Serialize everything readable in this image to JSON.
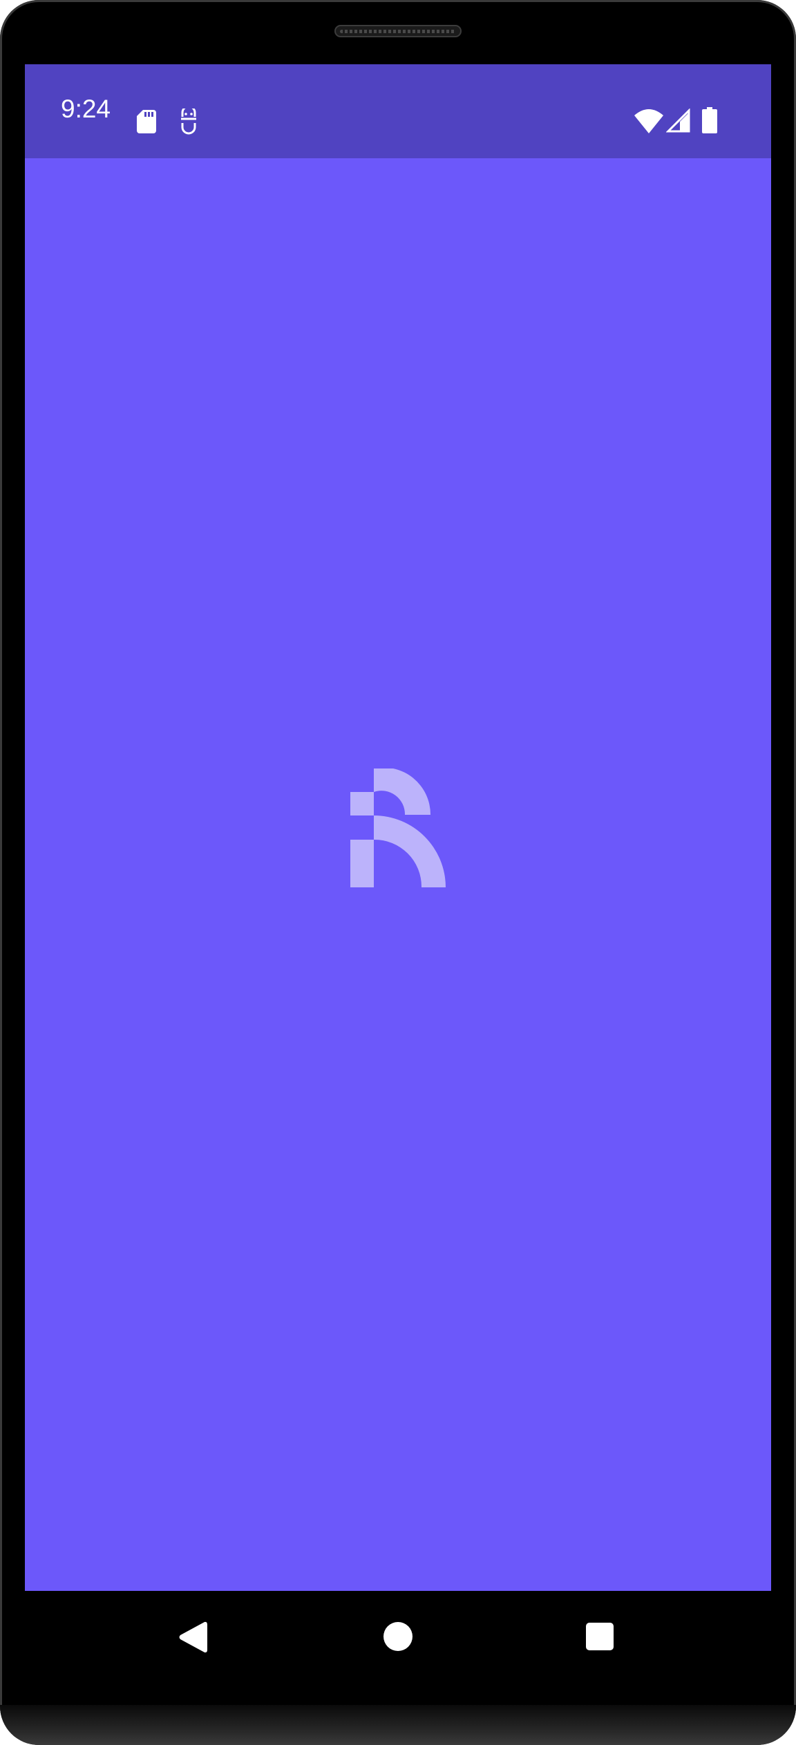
{
  "status_bar": {
    "time": "9:24",
    "left_icons": [
      "sd-card-icon",
      "debug-icon"
    ],
    "right_icons": [
      "wifi-icon",
      "cellular-signal-icon",
      "battery-icon"
    ]
  },
  "splash": {
    "logo": "app-logo"
  },
  "navigation": {
    "buttons": [
      "back-button",
      "home-button",
      "recents-button"
    ]
  },
  "colors": {
    "background": "#6c58fa",
    "status_bar": "#5043c1",
    "logo": "#bcb3fb",
    "device_frame": "#000000"
  }
}
